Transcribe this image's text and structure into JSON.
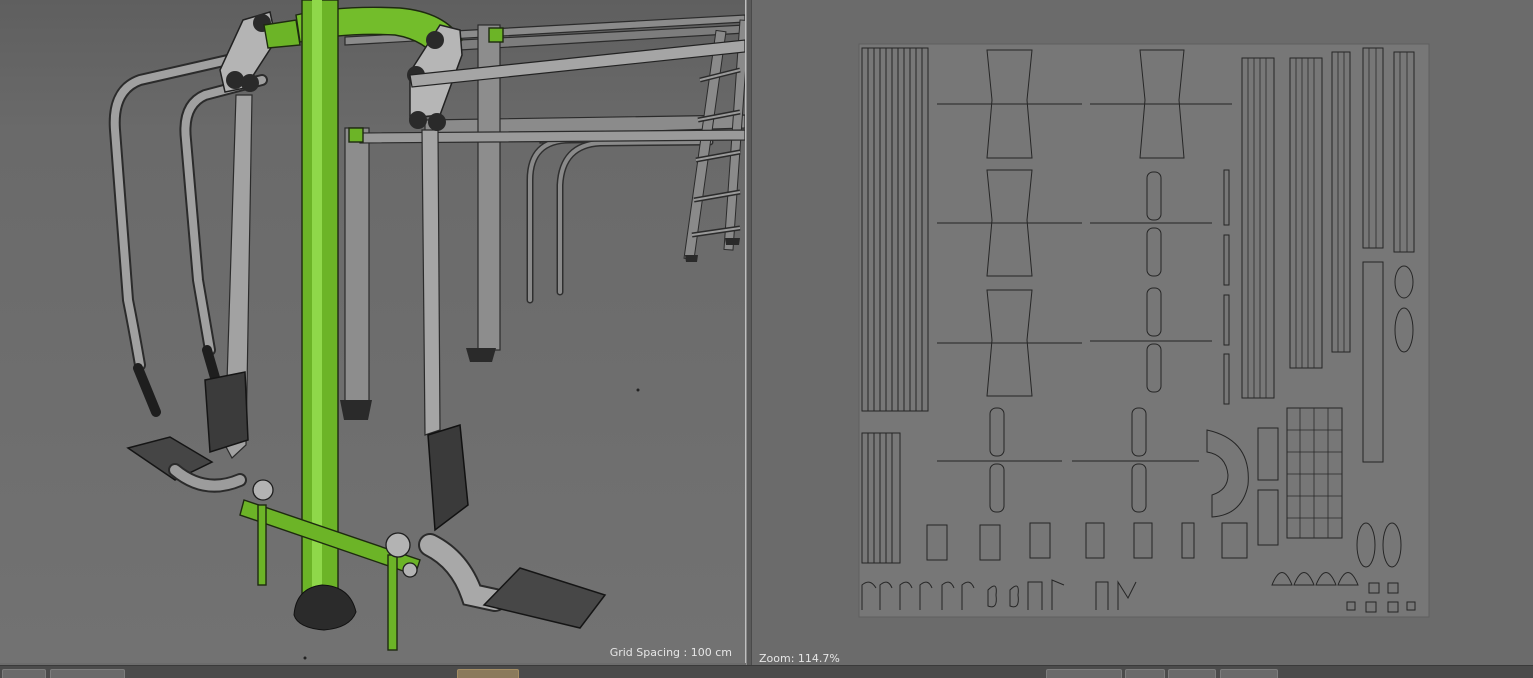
{
  "viewport_3d": {
    "grid_spacing_label": "Grid Spacing : 100 cm"
  },
  "viewport_uv": {
    "zoom_label": "Zoom: 114.7%"
  },
  "colors": {
    "accent_green": "#6cb427",
    "background_3d": "#6e6e6e",
    "background_uv": "#6b6b6b",
    "uv_sheet": "#777777"
  }
}
